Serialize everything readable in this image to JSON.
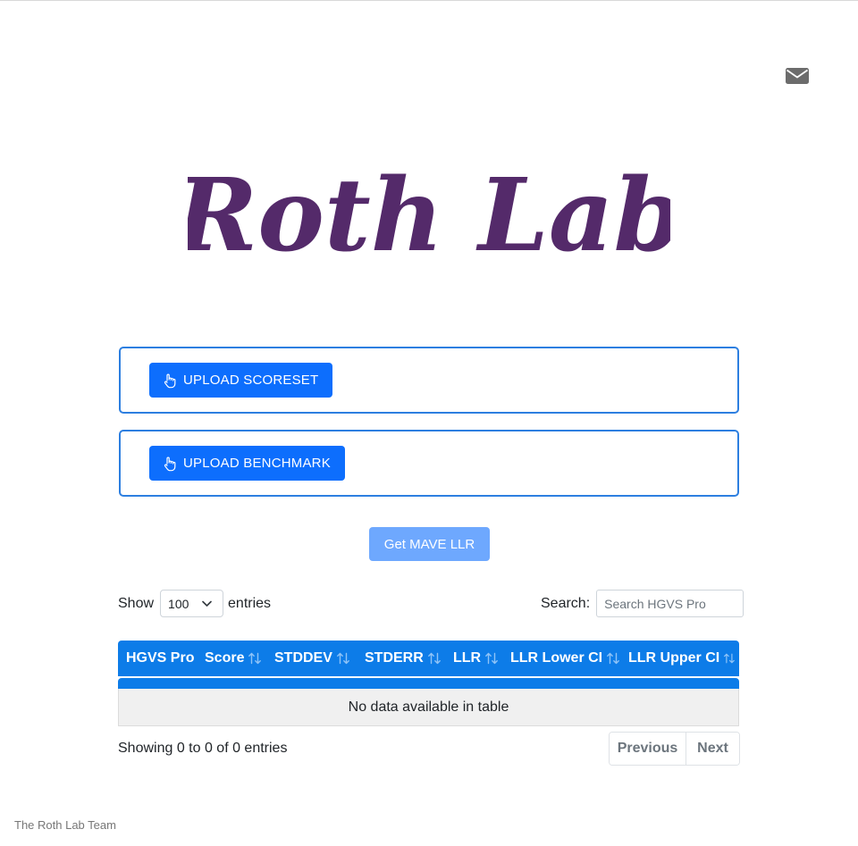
{
  "header": {
    "logo_text": "Roth Lab",
    "logo_color": "#542a6a"
  },
  "icons": {
    "mail": "envelope-icon",
    "upload": "hand-pointer-icon",
    "sort": "sort-arrows-icon",
    "dropdown": "chevron-down-icon"
  },
  "upload": {
    "scoreset_label": "UPLOAD SCORESET",
    "benchmark_label": "UPLOAD BENCHMARK"
  },
  "actions": {
    "get_llr_label": "Get MAVE LLR"
  },
  "table_controls": {
    "show_label": "Show",
    "entries_label": "entries",
    "page_length": "100",
    "search_label": "Search:",
    "search_placeholder": "Search HGVS Pro"
  },
  "table": {
    "columns": [
      "HGVS Pro",
      "Score",
      "STDDEV",
      "STDERR",
      "LLR",
      "LLR Lower CI",
      "LLR Upper CI"
    ],
    "empty_message": "No data available in table",
    "info": "Showing 0 to 0 of 0 entries"
  },
  "pagination": {
    "previous": "Previous",
    "next": "Next"
  },
  "footer": {
    "text": "The Roth Lab Team"
  },
  "colors": {
    "primary": "#0d6efd",
    "header_blue": "#0d7ce8",
    "box_border": "#2d7fe0",
    "disabled_button": "#6ea8fe"
  }
}
